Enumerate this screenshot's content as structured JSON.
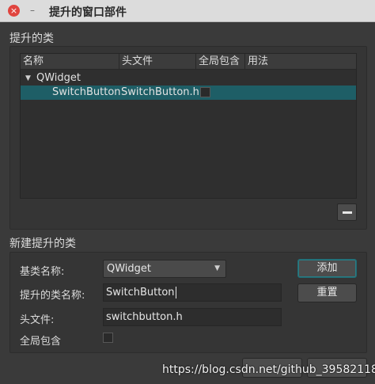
{
  "window": {
    "title": "提升的窗口部件",
    "close_glyph": "×",
    "min_glyph": "–"
  },
  "promoted": {
    "section_title": "提升的类",
    "columns": [
      "名称",
      "头文件",
      "全局包含",
      "用法"
    ],
    "base_node": "QWidget",
    "rows": [
      {
        "name": "SwitchButton",
        "header": "SwitchButton.h",
        "global_include": false,
        "usage": ""
      }
    ]
  },
  "new_promoted": {
    "section_title": "新建提升的类",
    "base_class_label": "基类名称:",
    "base_class_value": "QWidget",
    "promoted_class_label": "提升的类名称:",
    "promoted_class_value": "SwitchButton",
    "header_label": "头文件:",
    "header_value": "switchbutton.h",
    "global_include_label": "全局包含",
    "global_include_checked": false,
    "add_label": "添加",
    "reset_label": "重置"
  },
  "watermark": "https://blog.csdn.net/github_39582118",
  "colors": {
    "background": "#3a3a3a",
    "selection": "#1e5e66",
    "titlebar": "#dcdcdc",
    "close": "#e0443e"
  }
}
